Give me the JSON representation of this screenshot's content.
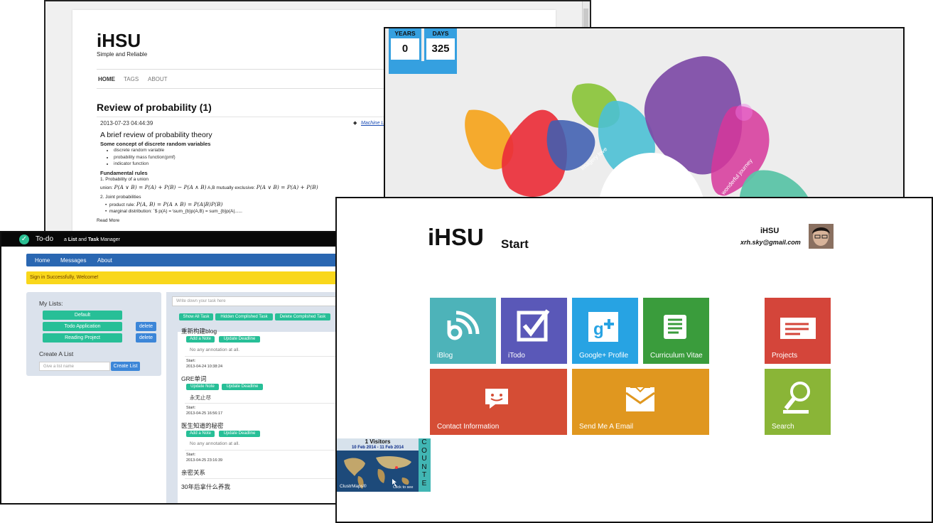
{
  "blog": {
    "site_title": "iHSU",
    "tagline": "Simple and Reliable",
    "nav": [
      "HOME",
      "TAGS",
      "ABOUT"
    ],
    "post_title": "Review of probability (1)",
    "post_date": "2013-07-23 04:44:39",
    "post_tag": "Machine Le",
    "h3": "A brief review of probability theory",
    "h4": "Some concept of discrete random variables",
    "bullets": [
      "discrete random variable",
      "probability mass function(pmf)",
      "indicator function"
    ],
    "h5_rules": "Fundamental rules",
    "rule1_title": "1. Probability of a union",
    "rule1_prefix": "union:",
    "rule1_formula": "P(A ∨ B) = P(A) + P(B) − P(A ∧ B)",
    "rule1_mid": "A,B mutually exclusive:",
    "rule1_formula2": "P(A ∨ B) = P(A) + P(B)",
    "rule2_title": "2. Joint probabilities",
    "rule2_b1_prefix": "product rule:",
    "rule2_b1_formula": "P(A, B) = P(A ∧ B) = P(A|B)P(B)",
    "rule2_b2": "marginal distribution: `$ p(A) = \\sum_{b}p(A,B) = sum_{b}p(A|......",
    "read_more": "Read More"
  },
  "timer": {
    "years_label": "YEARS",
    "years_value": "0",
    "days_label": "DAYS",
    "days_value": "325",
    "art_text_1": "Imagery love",
    "art_text_2": "A wonderful journey"
  },
  "todo": {
    "app_name": "To-do",
    "tagline_a": "a ",
    "tagline_b": "List",
    "tagline_c": " and ",
    "tagline_d": "Task",
    "tagline_e": " Manager",
    "nav": [
      "Home",
      "Messages",
      "About"
    ],
    "alert": "Sign in Successfully, Welcome!",
    "my_lists_label": "My Lists:",
    "lists": [
      "Default",
      "Todo Application",
      "Reading Project"
    ],
    "delete_label": "delete",
    "create_label": "Create A List",
    "list_placeholder": "Give a list name",
    "create_button": "Create List",
    "task_placeholder": "Write down your task here",
    "filters": [
      "Show All Task",
      "Hidden Complished Task",
      "Delete Complished Task"
    ],
    "tasks": [
      {
        "title": "重新构建blog",
        "btn1": "Add a Note",
        "btn2": "Update Deadline",
        "note": "No any annotation at all.",
        "start_label": "Start:",
        "start": "2013-04-24 10:38:24"
      },
      {
        "title": "GRE单词",
        "btn1": "Update Note",
        "btn2": "Update Deadline",
        "note": "永无止尽",
        "start_label": "Start:",
        "start": "2013-04-25 16:56:17"
      },
      {
        "title": "医生知道的秘密",
        "btn1": "Add a Note",
        "btn2": "Update Deadline",
        "note": "No any annotation at all.",
        "start_label": "Start:",
        "start": "2013-04-25 23:16:39"
      },
      {
        "title": "亲密关系"
      },
      {
        "title": "30年后拿什么养我"
      }
    ]
  },
  "start": {
    "title": "iHSU",
    "subtitle": "Start",
    "user": "iHSU",
    "email": "xrh.sky@gmail.com",
    "tiles": [
      "iBlog",
      "iTodo",
      "Google+ Profile",
      "Curriculum Vitae",
      "Projects",
      "Contact Information",
      "Send Me A Email",
      "Search"
    ],
    "tile_colors": [
      "#4db3b9",
      "#5a58b8",
      "#27a3e3",
      "#3a9c3c",
      "#d4453a",
      "#d54d35",
      "#e0971f",
      "#8ab537"
    ],
    "clustr_visitors": "1 Visitors",
    "clustr_dates": "10 Feb 2014 - 11 Feb 2014",
    "clustr_brand": "ClustrMaps®",
    "clustr_click": "Click to see",
    "counter": [
      "C",
      "O",
      "U",
      "N",
      "T",
      "E"
    ]
  }
}
